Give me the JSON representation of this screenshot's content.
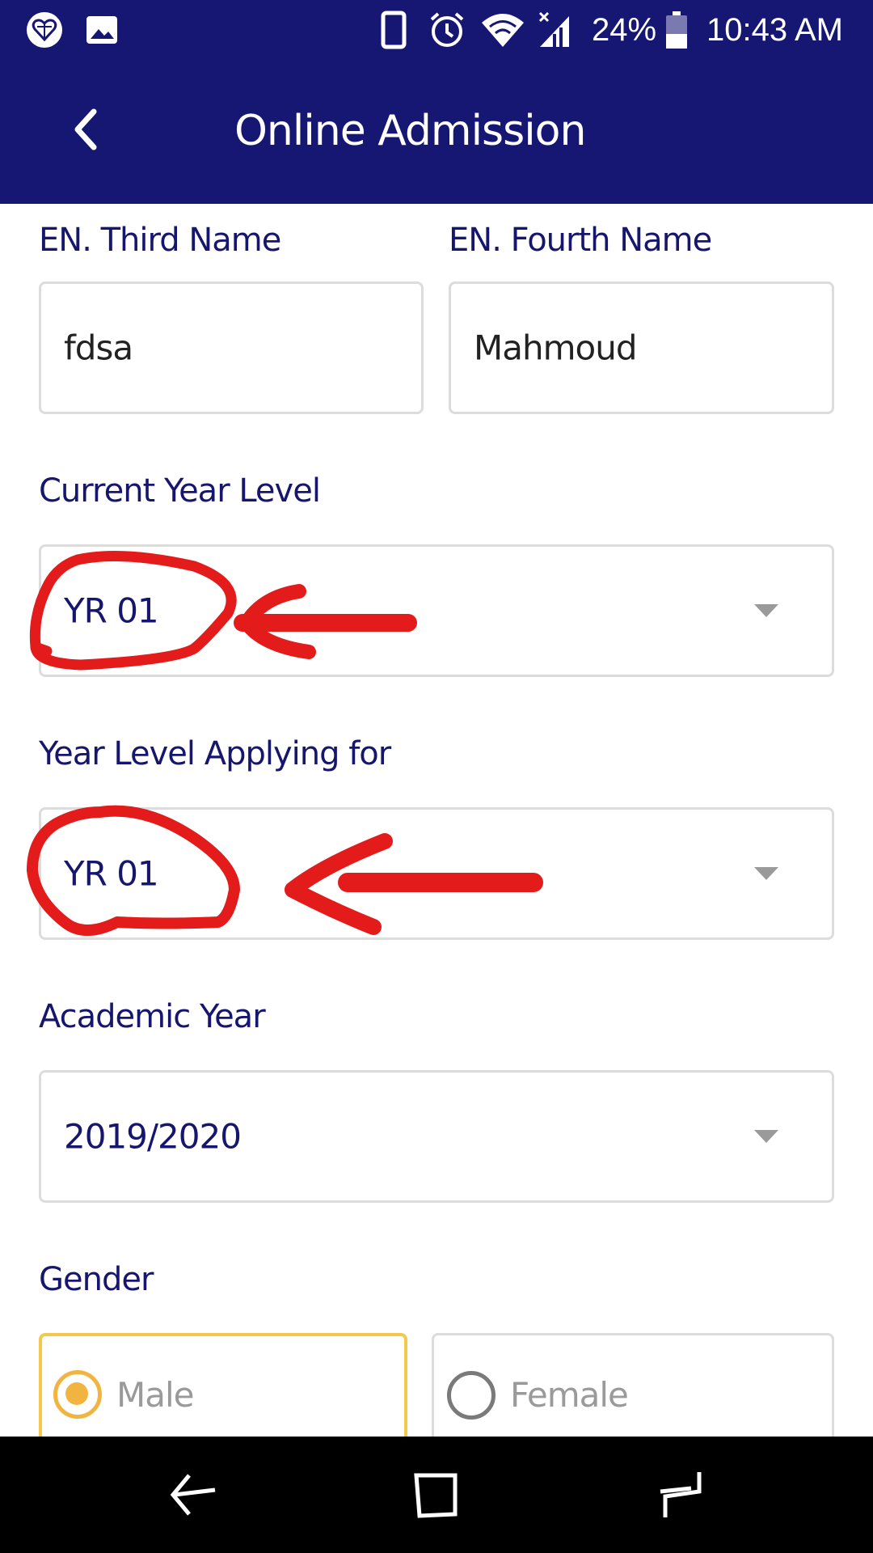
{
  "status_bar": {
    "battery": "24%",
    "time": "10:43 AM",
    "icons": [
      "heart-app-icon",
      "gallery-icon",
      "phone-icon",
      "alarm-icon",
      "wifi-icon",
      "signal-icon",
      "battery-icon"
    ]
  },
  "app_bar": {
    "title": "Online Admission",
    "back_icon": "chevron-left-icon"
  },
  "form": {
    "third_name": {
      "label": "EN. Third Name",
      "value": "fdsa"
    },
    "fourth_name": {
      "label": "EN. Fourth Name",
      "value": "Mahmoud"
    },
    "current_year_level": {
      "label": "Current Year Level",
      "value": "YR 01"
    },
    "year_level_applying": {
      "label": "Year Level Applying for",
      "value": "YR 01"
    },
    "academic_year": {
      "label": "Academic Year",
      "value": "2019/2020"
    },
    "gender": {
      "label": "Gender",
      "options": [
        {
          "label": "Male",
          "selected": true
        },
        {
          "label": "Female",
          "selected": false
        }
      ]
    }
  },
  "colors": {
    "primary": "#161673",
    "accent_selected": "#f2b441",
    "annotation": "#e31b1b"
  },
  "nav_bar": {
    "icons": [
      "back-nav-icon",
      "recents-nav-icon",
      "home-nav-icon"
    ]
  }
}
